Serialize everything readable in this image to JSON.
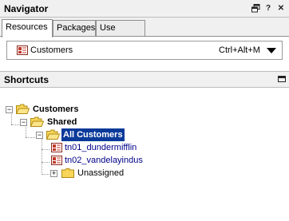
{
  "navigator": {
    "title": "Navigator",
    "tabs": [
      {
        "label": "Resources",
        "active": true
      },
      {
        "label": "Packages",
        "active": false
      },
      {
        "label": "Use Cases",
        "active": false
      }
    ],
    "selector": {
      "label": "Customers",
      "shortcut": "Ctrl+Alt+M",
      "icon": "customer-card-icon"
    },
    "header_icons": [
      "restore-icon",
      "help-icon",
      "close-icon"
    ]
  },
  "shortcuts": {
    "title": "Shortcuts",
    "tree": {
      "root": {
        "label": "Customers",
        "icon": "folder-open-icon"
      },
      "shared": {
        "label": "Shared",
        "icon": "folder-open-icon"
      },
      "all_customers": {
        "label": "All Customers",
        "icon": "folder-open-icon",
        "selected": true
      },
      "items": [
        {
          "label": "tn01_dundermifflin",
          "icon": "customer-card-icon"
        },
        {
          "label": "tn02_vandelayindus",
          "icon": "customer-card-icon"
        }
      ],
      "unassigned": {
        "label": "Unassigned",
        "icon": "folder-closed-icon"
      }
    }
  },
  "colors": {
    "selection_bg": "#0a3a9a",
    "link_text": "#00008b",
    "folder_yellow": "#f7d65a",
    "card_red": "#c0392b"
  }
}
